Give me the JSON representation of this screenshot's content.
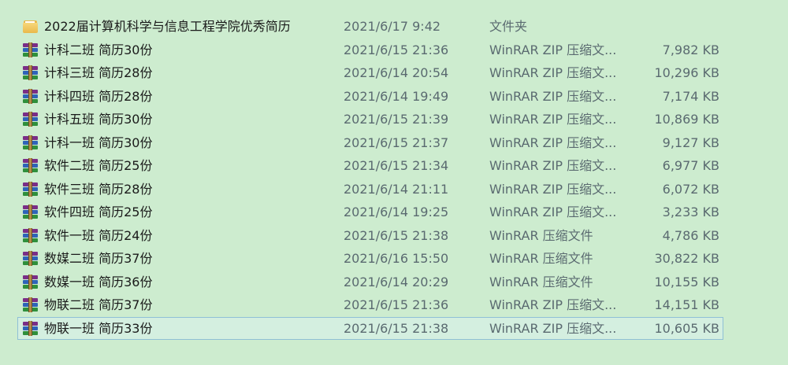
{
  "files": [
    {
      "name": "2022届计算机科学与信息工程学院优秀简历",
      "date": "2021/6/17 9:42",
      "type": "文件夹",
      "size": "",
      "icon": "folder-icon",
      "selected": false
    },
    {
      "name": "计科二班 简历30份",
      "date": "2021/6/15 21:36",
      "type": "WinRAR ZIP 压缩文...",
      "size": "7,982 KB",
      "icon": "winrar-archive-icon",
      "selected": false
    },
    {
      "name": "计科三班 简历28份",
      "date": "2021/6/14 20:54",
      "type": "WinRAR ZIP 压缩文...",
      "size": "10,296 KB",
      "icon": "winrar-archive-icon",
      "selected": false
    },
    {
      "name": "计科四班 简历28份",
      "date": "2021/6/14 19:49",
      "type": "WinRAR ZIP 压缩文...",
      "size": "7,174 KB",
      "icon": "winrar-archive-icon",
      "selected": false
    },
    {
      "name": "计科五班 简历30份",
      "date": "2021/6/15 21:39",
      "type": "WinRAR ZIP 压缩文...",
      "size": "10,869 KB",
      "icon": "winrar-archive-icon",
      "selected": false
    },
    {
      "name": "计科一班 简历30份",
      "date": "2021/6/15 21:37",
      "type": "WinRAR ZIP 压缩文...",
      "size": "9,127 KB",
      "icon": "winrar-archive-icon",
      "selected": false
    },
    {
      "name": "软件二班 简历25份",
      "date": "2021/6/15 21:34",
      "type": "WinRAR ZIP 压缩文...",
      "size": "6,977 KB",
      "icon": "winrar-archive-icon",
      "selected": false
    },
    {
      "name": "软件三班 简历28份",
      "date": "2021/6/14 21:11",
      "type": "WinRAR ZIP 压缩文...",
      "size": "6,072 KB",
      "icon": "winrar-archive-icon",
      "selected": false
    },
    {
      "name": "软件四班 简历25份",
      "date": "2021/6/14 19:25",
      "type": "WinRAR ZIP 压缩文...",
      "size": "3,233 KB",
      "icon": "winrar-archive-icon",
      "selected": false
    },
    {
      "name": "软件一班 简历24份",
      "date": "2021/6/15 21:38",
      "type": "WinRAR 压缩文件",
      "size": "4,786 KB",
      "icon": "winrar-archive-icon",
      "selected": false
    },
    {
      "name": "数媒二班 简历37份",
      "date": "2021/6/16 15:50",
      "type": "WinRAR 压缩文件",
      "size": "30,822 KB",
      "icon": "winrar-archive-icon",
      "selected": false
    },
    {
      "name": "数媒一班 简历36份",
      "date": "2021/6/14 20:29",
      "type": "WinRAR 压缩文件",
      "size": "10,155 KB",
      "icon": "winrar-archive-icon",
      "selected": false
    },
    {
      "name": "物联二班 简历37份",
      "date": "2021/6/15 21:36",
      "type": "WinRAR ZIP 压缩文...",
      "size": "14,151 KB",
      "icon": "winrar-archive-icon",
      "selected": false
    },
    {
      "name": "物联一班 简历33份",
      "date": "2021/6/15 21:38",
      "type": "WinRAR ZIP 压缩文...",
      "size": "10,605 KB",
      "icon": "winrar-archive-icon",
      "selected": true
    }
  ]
}
